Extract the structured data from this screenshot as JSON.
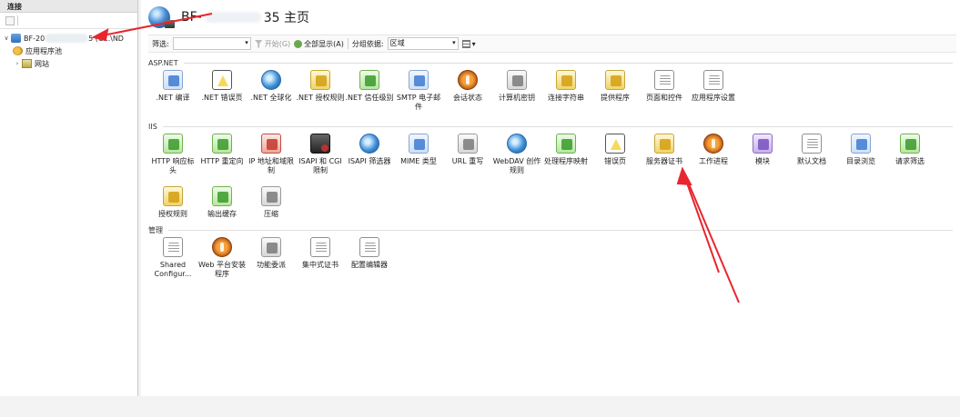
{
  "left": {
    "header": "连接",
    "tree": {
      "server_prefix": "BF-20",
      "server_suffix": "5 (C...\\ND",
      "app_pools": "应用程序池",
      "sites": "网站"
    }
  },
  "main": {
    "title_prefix": "BF-",
    "title_suffix": "35 主页",
    "filter": {
      "label": "筛选:",
      "start": "开始(G)",
      "show_all": "全部显示(A)",
      "group_label": "分组依据:",
      "group_value": "区域"
    },
    "groups": [
      {
        "title": "ASP.NET",
        "items": [
          {
            "label": ".NET 编译",
            "icon": "compile-icon"
          },
          {
            "label": ".NET 错误页",
            "icon": "error-page-icon"
          },
          {
            "label": ".NET 全球化",
            "icon": "globalization-icon"
          },
          {
            "label": ".NET 授权规则",
            "icon": "authorization-icon"
          },
          {
            "label": ".NET 信任级别",
            "icon": "trust-level-icon"
          },
          {
            "label": "SMTP 电子邮件",
            "icon": "smtp-icon"
          },
          {
            "label": "会话状态",
            "icon": "session-state-icon"
          },
          {
            "label": "计算机密钥",
            "icon": "machine-key-icon"
          },
          {
            "label": "连接字符串",
            "icon": "connection-string-icon"
          },
          {
            "label": "提供程序",
            "icon": "providers-icon"
          },
          {
            "label": "页面和控件",
            "icon": "pages-controls-icon"
          },
          {
            "label": "应用程序设置",
            "icon": "app-settings-icon"
          }
        ]
      },
      {
        "title": "IIS",
        "items": [
          {
            "label": "HTTP 响应标头",
            "icon": "http-headers-icon"
          },
          {
            "label": "HTTP 重定向",
            "icon": "http-redirect-icon"
          },
          {
            "label": "IP 地址和域限制",
            "icon": "ip-restrictions-icon"
          },
          {
            "label": "ISAPI 和 CGI 限制",
            "icon": "isapi-cgi-icon"
          },
          {
            "label": "ISAPI 筛选器",
            "icon": "isapi-filter-icon"
          },
          {
            "label": "MIME 类型",
            "icon": "mime-icon"
          },
          {
            "label": "URL 重写",
            "icon": "url-rewrite-icon"
          },
          {
            "label": "WebDAV 创作规则",
            "icon": "webdav-icon"
          },
          {
            "label": "处理程序映射",
            "icon": "handler-mappings-icon"
          },
          {
            "label": "错误页",
            "icon": "error-pages-icon"
          },
          {
            "label": "服务器证书",
            "icon": "server-certificates-icon"
          },
          {
            "label": "工作进程",
            "icon": "worker-processes-icon"
          },
          {
            "label": "模块",
            "icon": "modules-icon"
          },
          {
            "label": "默认文档",
            "icon": "default-document-icon"
          },
          {
            "label": "目录浏览",
            "icon": "directory-browsing-icon"
          },
          {
            "label": "请求筛选",
            "icon": "request-filtering-icon"
          },
          {
            "label": "授权规则",
            "icon": "auth-rules-icon"
          },
          {
            "label": "输出缓存",
            "icon": "output-cache-icon"
          },
          {
            "label": "压缩",
            "icon": "compression-icon"
          }
        ]
      },
      {
        "title": "管理",
        "items": [
          {
            "label": "Shared Configur...",
            "icon": "shared-config-icon"
          },
          {
            "label": "Web 平台安装程序",
            "icon": "web-platform-installer-icon"
          },
          {
            "label": "功能委派",
            "icon": "feature-delegation-icon"
          },
          {
            "label": "集中式证书",
            "icon": "centralized-certs-icon"
          },
          {
            "label": "配置编辑器",
            "icon": "config-editor-icon"
          }
        ]
      }
    ]
  },
  "colors": {
    "arrow": "#e8262d",
    "accent": "#3d7bd3"
  }
}
